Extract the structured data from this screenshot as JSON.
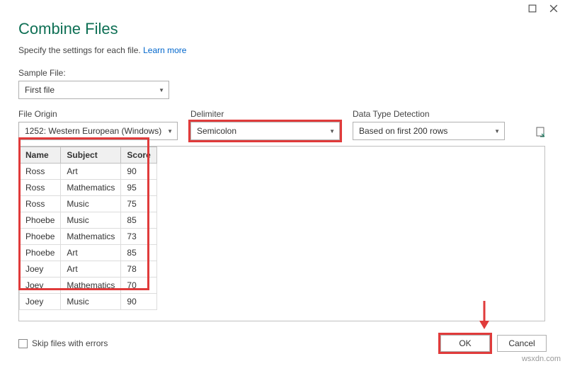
{
  "titlebar": {},
  "heading": "Combine Files",
  "subtitle_text": "Specify the settings for each file.",
  "learn_more": "Learn more",
  "sample_file": {
    "label": "Sample File:",
    "value": "First file"
  },
  "file_origin": {
    "label": "File Origin",
    "value": "1252: Western European (Windows)"
  },
  "delimiter": {
    "label": "Delimiter",
    "value": "Semicolon"
  },
  "detection": {
    "label": "Data Type Detection",
    "value": "Based on first 200 rows"
  },
  "preview": {
    "columns": [
      "Name",
      "Subject",
      "Score"
    ],
    "rows": [
      [
        "Ross",
        "Art",
        "90"
      ],
      [
        "Ross",
        "Mathematics",
        "95"
      ],
      [
        "Ross",
        "Music",
        "75"
      ],
      [
        "Phoebe",
        "Music",
        "85"
      ],
      [
        "Phoebe",
        "Mathematics",
        "73"
      ],
      [
        "Phoebe",
        "Art",
        "85"
      ],
      [
        "Joey",
        "Art",
        "78"
      ],
      [
        "Joey",
        "Mathematics",
        "70"
      ],
      [
        "Joey",
        "Music",
        "90"
      ]
    ]
  },
  "skip_errors": {
    "label": "Skip files with errors",
    "checked": false
  },
  "buttons": {
    "ok": "OK",
    "cancel": "Cancel"
  },
  "watermark": "wsxdn.com"
}
